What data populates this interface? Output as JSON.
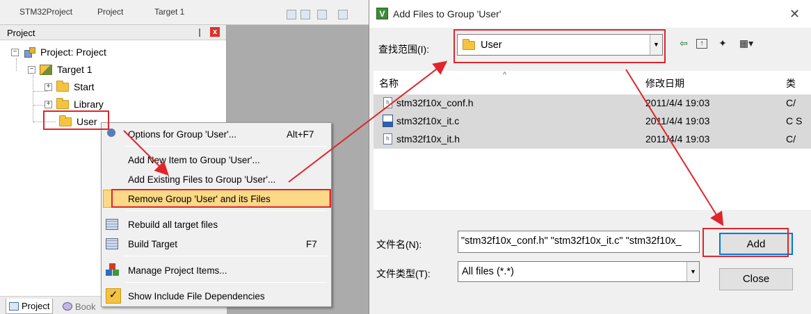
{
  "ide": {
    "toolbar_text_1": "STM32Project",
    "toolbar_text_2": "Project",
    "toolbar_text_3": "Target 1"
  },
  "project_panel": {
    "title": "Project",
    "pin": "❘",
    "close": "x",
    "tree": {
      "root": "Project: Project",
      "target": "Target 1",
      "groups": [
        "Start",
        "Library",
        "User"
      ]
    },
    "tabs": [
      "Project",
      "Book"
    ]
  },
  "context_menu": {
    "items": [
      {
        "label": "Options for Group 'User'...",
        "shortcut": "Alt+F7",
        "icon": "options-wand-icon"
      },
      {
        "label": "Add New  Item to Group 'User'...",
        "shortcut": "",
        "icon": ""
      },
      {
        "label": "Add Existing Files to Group 'User'...",
        "shortcut": "",
        "icon": ""
      },
      {
        "label": "Remove Group 'User' and its Files",
        "shortcut": "",
        "icon": "",
        "highlighted": true
      },
      {
        "label": "Rebuild all target files",
        "shortcut": "",
        "icon": "rebuild-icon"
      },
      {
        "label": "Build Target",
        "shortcut": "F7",
        "icon": "build-icon"
      },
      {
        "label": "Manage Project Items...",
        "shortcut": "",
        "icon": "manage-items-icon"
      },
      {
        "label": "Show Include File Dependencies",
        "shortcut": "",
        "icon": "check-icon"
      }
    ]
  },
  "dialog": {
    "title": "Add Files to Group 'User'",
    "lookin_label": "查找范围(I):",
    "lookin_value": "User",
    "nav_icons": [
      "back-arrow-icon",
      "up-folder-icon",
      "new-folder-icon",
      "view-menu-icon"
    ],
    "columns": [
      "名称",
      "修改日期",
      "类"
    ],
    "files": [
      {
        "name": "stm32f10x_conf.h",
        "date": "2011/4/4 19:03",
        "type": "C/",
        "icon": "h-file-icon"
      },
      {
        "name": "stm32f10x_it.c",
        "date": "2011/4/4 19:03",
        "type": "C S",
        "icon": "c-file-icon"
      },
      {
        "name": "stm32f10x_it.h",
        "date": "2011/4/4 19:03",
        "type": "C/",
        "icon": "h-file-icon"
      }
    ],
    "filename_label": "文件名(N):",
    "filename_value": "\"stm32f10x_conf.h\" \"stm32f10x_it.c\" \"stm32f10x_",
    "filetype_label": "文件类型(T):",
    "filetype_value": "All files (*.*)",
    "add_label": "Add",
    "close_label": "Close"
  },
  "colors": {
    "annotation_red": "#e0242c",
    "menu_highlight": "#fbd986",
    "selected_row": "#d9d9d9",
    "default_button_border": "#0078d7"
  }
}
